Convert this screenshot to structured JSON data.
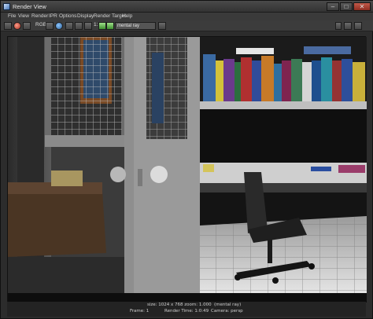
{
  "window": {
    "title": "Render View"
  },
  "menu": {
    "items": [
      "File",
      "View",
      "Render",
      "IPR",
      "Options",
      "Display",
      "Render Target",
      "Help"
    ]
  },
  "toolbar": {
    "renderer": "mental ray",
    "channel_label": "RGB",
    "ratio_label": "1:1",
    "icons": [
      "redo-render-icon",
      "ipr-render-icon",
      "refresh-icon",
      "render-region-icon",
      "snapshot-icon",
      "camera-icon",
      "keep-image-icon",
      "remove-image-icon",
      "display-rgb-icon",
      "display-alpha-icon",
      "real-size-icon",
      "ratio-icon",
      "pause-icon",
      "renderer-menu-icon"
    ]
  },
  "status": {
    "line1": "size: 1024 x 768  zoom: 1.000",
    "line1b": "(mental ray)",
    "line2_frame": "Frame: 1",
    "line2_time": "Render Time: 1:0:49",
    "line2_camera": "Camera: persp"
  },
  "colors": {
    "window_bg": "#2c2c2c",
    "titlebar": "#3a3a3a",
    "accent_green": "#5db34a"
  }
}
